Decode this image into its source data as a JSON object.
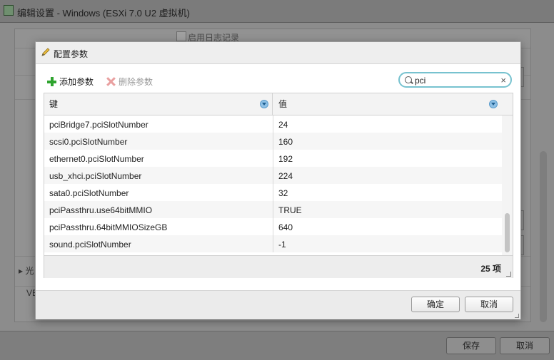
{
  "window": {
    "title": "编辑设置 - Windows (ESXi 7.0 U2 虚拟机)",
    "checkbox_label": "启用日志记录",
    "side_texts": [
      "光",
      "VE"
    ],
    "footer": {
      "save_label": "保存",
      "cancel_label": "取消"
    }
  },
  "dialog": {
    "title": "配置参数",
    "toolbar": {
      "add_label": "添加参数",
      "delete_label": "删除参数"
    },
    "search": {
      "value": "pci",
      "clear_glyph": "×"
    },
    "columns": {
      "key": "键",
      "value": "值"
    },
    "rows": [
      {
        "key": "pciBridge7.pciSlotNumber",
        "value": "24"
      },
      {
        "key": "scsi0.pciSlotNumber",
        "value": "160"
      },
      {
        "key": "ethernet0.pciSlotNumber",
        "value": "192"
      },
      {
        "key": "usb_xhci.pciSlotNumber",
        "value": "224"
      },
      {
        "key": "sata0.pciSlotNumber",
        "value": "32"
      },
      {
        "key": "pciPassthru.use64bitMMIO",
        "value": "TRUE"
      },
      {
        "key": "pciPassthru.64bitMMIOSizeGB",
        "value": "640"
      },
      {
        "key": "sound.pciSlotNumber",
        "value": "-1"
      }
    ],
    "count_label": "25 项",
    "footer": {
      "ok_label": "确定",
      "cancel_label": "取消"
    }
  },
  "colors": {
    "search_border": "#77c2cf",
    "add_icon": "#2fa42f",
    "delete_icon_disabled": "#e9a0a0",
    "sort_icon": "#8fc1e6"
  }
}
